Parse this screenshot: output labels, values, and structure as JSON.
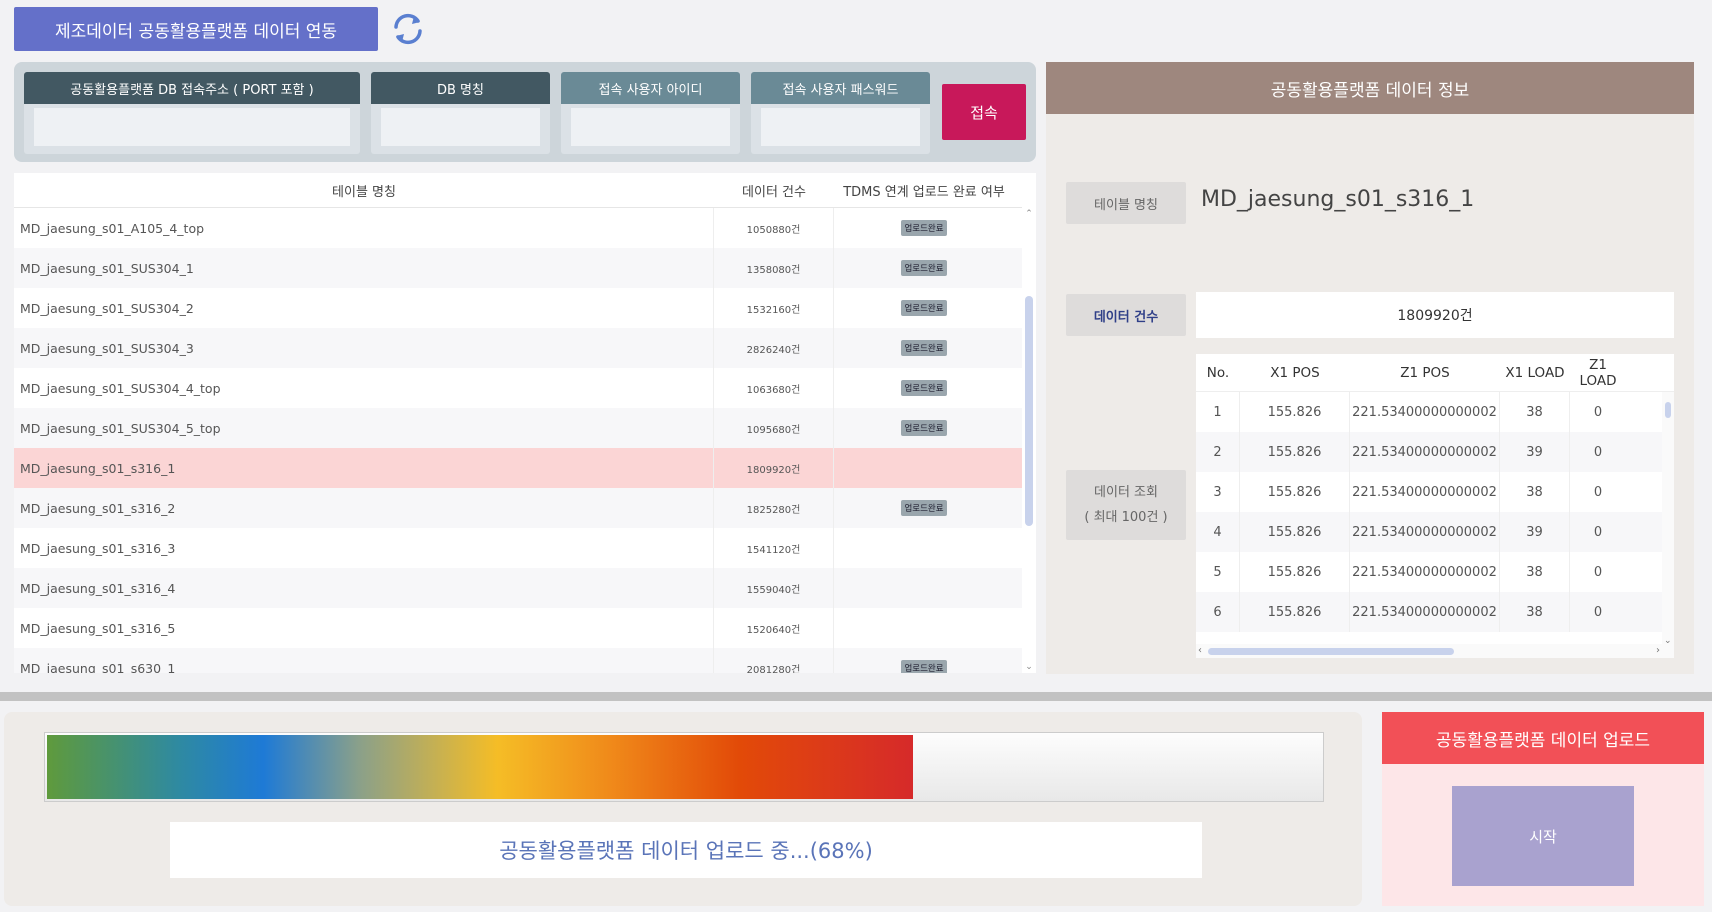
{
  "header": {
    "title": "제조데이터 공동활용플랫폼 데이터 연동",
    "refresh_icon": "refresh-icon"
  },
  "connection": {
    "db_address_label": "공동활용플랫폼 DB 접속주소 ( PORT 포함 )",
    "db_address_value": "",
    "db_name_label": "DB 명칭",
    "db_name_value": "",
    "user_id_label": "접속 사용자 아이디",
    "user_id_value": "",
    "password_label": "접속 사용자 패스워드",
    "password_value": "",
    "connect_label": "접속"
  },
  "table_list": {
    "columns": [
      "테이블 명칭",
      "데이터 건수",
      "TDMS 연계 업로드 완료 여부"
    ],
    "rows": [
      {
        "name": "MD_jaesung_s01_A105_4_top",
        "count": "1050880건",
        "status": "업로드완료"
      },
      {
        "name": "MD_jaesung_s01_SUS304_1",
        "count": "1358080건",
        "status": "업로드완료"
      },
      {
        "name": "MD_jaesung_s01_SUS304_2",
        "count": "1532160건",
        "status": "업로드완료"
      },
      {
        "name": "MD_jaesung_s01_SUS304_3",
        "count": "2826240건",
        "status": "업로드완료"
      },
      {
        "name": "MD_jaesung_s01_SUS304_4_top",
        "count": "1063680건",
        "status": "업로드완료"
      },
      {
        "name": "MD_jaesung_s01_SUS304_5_top",
        "count": "1095680건",
        "status": "업로드완료"
      },
      {
        "name": "MD_jaesung_s01_s316_1",
        "count": "1809920건",
        "status": "",
        "selected": true
      },
      {
        "name": "MD_jaesung_s01_s316_2",
        "count": "1825280건",
        "status": "업로드완료"
      },
      {
        "name": "MD_jaesung_s01_s316_3",
        "count": "1541120건",
        "status": ""
      },
      {
        "name": "MD_jaesung_s01_s316_4",
        "count": "1559040건",
        "status": ""
      },
      {
        "name": "MD_jaesung_s01_s316_5",
        "count": "1520640건",
        "status": ""
      },
      {
        "name": "MD_jaesung_s01_s630_1",
        "count": "2081280건",
        "status": "업로드완료"
      }
    ]
  },
  "info": {
    "title": "공동활용플랫폼 데이터 정보",
    "table_name_label": "테이블 명칭",
    "table_name_value": "MD_jaesung_s01_s316_1",
    "count_label": "데이터 건수",
    "count_value": "1809920건",
    "query_label_line1": "데이터 조회",
    "query_label_line2": "( 최대 100건 )",
    "data_columns": [
      "No.",
      "X1 POS",
      "Z1 POS",
      "X1 LOAD",
      "Z1 LOAD"
    ],
    "data_rows": [
      [
        "1",
        "155.826",
        "221.53400000000002",
        "38",
        "0"
      ],
      [
        "2",
        "155.826",
        "221.53400000000002",
        "39",
        "0"
      ],
      [
        "3",
        "155.826",
        "221.53400000000002",
        "38",
        "0"
      ],
      [
        "4",
        "155.826",
        "221.53400000000002",
        "39",
        "0"
      ],
      [
        "5",
        "155.826",
        "221.53400000000002",
        "38",
        "0"
      ],
      [
        "6",
        "155.826",
        "221.53400000000002",
        "38",
        "0"
      ]
    ]
  },
  "progress": {
    "percent": 68,
    "status_text": "공동활용플랫폼 데이터 업로드 중...(68%)"
  },
  "upload": {
    "title": "공동활용플랫폼 데이터 업로드",
    "start_label": "시작"
  }
}
